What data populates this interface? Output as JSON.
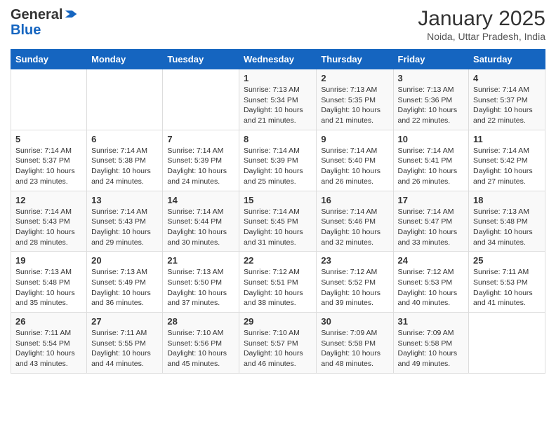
{
  "header": {
    "logo_general": "General",
    "logo_blue": "Blue",
    "month": "January 2025",
    "location": "Noida, Uttar Pradesh, India"
  },
  "days_of_week": [
    "Sunday",
    "Monday",
    "Tuesday",
    "Wednesday",
    "Thursday",
    "Friday",
    "Saturday"
  ],
  "weeks": [
    [
      {
        "day": "",
        "info": ""
      },
      {
        "day": "",
        "info": ""
      },
      {
        "day": "",
        "info": ""
      },
      {
        "day": "1",
        "info": "Sunrise: 7:13 AM\nSunset: 5:34 PM\nDaylight: 10 hours and 21 minutes."
      },
      {
        "day": "2",
        "info": "Sunrise: 7:13 AM\nSunset: 5:35 PM\nDaylight: 10 hours and 21 minutes."
      },
      {
        "day": "3",
        "info": "Sunrise: 7:13 AM\nSunset: 5:36 PM\nDaylight: 10 hours and 22 minutes."
      },
      {
        "day": "4",
        "info": "Sunrise: 7:14 AM\nSunset: 5:37 PM\nDaylight: 10 hours and 22 minutes."
      }
    ],
    [
      {
        "day": "5",
        "info": "Sunrise: 7:14 AM\nSunset: 5:37 PM\nDaylight: 10 hours and 23 minutes."
      },
      {
        "day": "6",
        "info": "Sunrise: 7:14 AM\nSunset: 5:38 PM\nDaylight: 10 hours and 24 minutes."
      },
      {
        "day": "7",
        "info": "Sunrise: 7:14 AM\nSunset: 5:39 PM\nDaylight: 10 hours and 24 minutes."
      },
      {
        "day": "8",
        "info": "Sunrise: 7:14 AM\nSunset: 5:39 PM\nDaylight: 10 hours and 25 minutes."
      },
      {
        "day": "9",
        "info": "Sunrise: 7:14 AM\nSunset: 5:40 PM\nDaylight: 10 hours and 26 minutes."
      },
      {
        "day": "10",
        "info": "Sunrise: 7:14 AM\nSunset: 5:41 PM\nDaylight: 10 hours and 26 minutes."
      },
      {
        "day": "11",
        "info": "Sunrise: 7:14 AM\nSunset: 5:42 PM\nDaylight: 10 hours and 27 minutes."
      }
    ],
    [
      {
        "day": "12",
        "info": "Sunrise: 7:14 AM\nSunset: 5:43 PM\nDaylight: 10 hours and 28 minutes."
      },
      {
        "day": "13",
        "info": "Sunrise: 7:14 AM\nSunset: 5:43 PM\nDaylight: 10 hours and 29 minutes."
      },
      {
        "day": "14",
        "info": "Sunrise: 7:14 AM\nSunset: 5:44 PM\nDaylight: 10 hours and 30 minutes."
      },
      {
        "day": "15",
        "info": "Sunrise: 7:14 AM\nSunset: 5:45 PM\nDaylight: 10 hours and 31 minutes."
      },
      {
        "day": "16",
        "info": "Sunrise: 7:14 AM\nSunset: 5:46 PM\nDaylight: 10 hours and 32 minutes."
      },
      {
        "day": "17",
        "info": "Sunrise: 7:14 AM\nSunset: 5:47 PM\nDaylight: 10 hours and 33 minutes."
      },
      {
        "day": "18",
        "info": "Sunrise: 7:13 AM\nSunset: 5:48 PM\nDaylight: 10 hours and 34 minutes."
      }
    ],
    [
      {
        "day": "19",
        "info": "Sunrise: 7:13 AM\nSunset: 5:48 PM\nDaylight: 10 hours and 35 minutes."
      },
      {
        "day": "20",
        "info": "Sunrise: 7:13 AM\nSunset: 5:49 PM\nDaylight: 10 hours and 36 minutes."
      },
      {
        "day": "21",
        "info": "Sunrise: 7:13 AM\nSunset: 5:50 PM\nDaylight: 10 hours and 37 minutes."
      },
      {
        "day": "22",
        "info": "Sunrise: 7:12 AM\nSunset: 5:51 PM\nDaylight: 10 hours and 38 minutes."
      },
      {
        "day": "23",
        "info": "Sunrise: 7:12 AM\nSunset: 5:52 PM\nDaylight: 10 hours and 39 minutes."
      },
      {
        "day": "24",
        "info": "Sunrise: 7:12 AM\nSunset: 5:53 PM\nDaylight: 10 hours and 40 minutes."
      },
      {
        "day": "25",
        "info": "Sunrise: 7:11 AM\nSunset: 5:53 PM\nDaylight: 10 hours and 41 minutes."
      }
    ],
    [
      {
        "day": "26",
        "info": "Sunrise: 7:11 AM\nSunset: 5:54 PM\nDaylight: 10 hours and 43 minutes."
      },
      {
        "day": "27",
        "info": "Sunrise: 7:11 AM\nSunset: 5:55 PM\nDaylight: 10 hours and 44 minutes."
      },
      {
        "day": "28",
        "info": "Sunrise: 7:10 AM\nSunset: 5:56 PM\nDaylight: 10 hours and 45 minutes."
      },
      {
        "day": "29",
        "info": "Sunrise: 7:10 AM\nSunset: 5:57 PM\nDaylight: 10 hours and 46 minutes."
      },
      {
        "day": "30",
        "info": "Sunrise: 7:09 AM\nSunset: 5:58 PM\nDaylight: 10 hours and 48 minutes."
      },
      {
        "day": "31",
        "info": "Sunrise: 7:09 AM\nSunset: 5:58 PM\nDaylight: 10 hours and 49 minutes."
      },
      {
        "day": "",
        "info": ""
      }
    ]
  ]
}
